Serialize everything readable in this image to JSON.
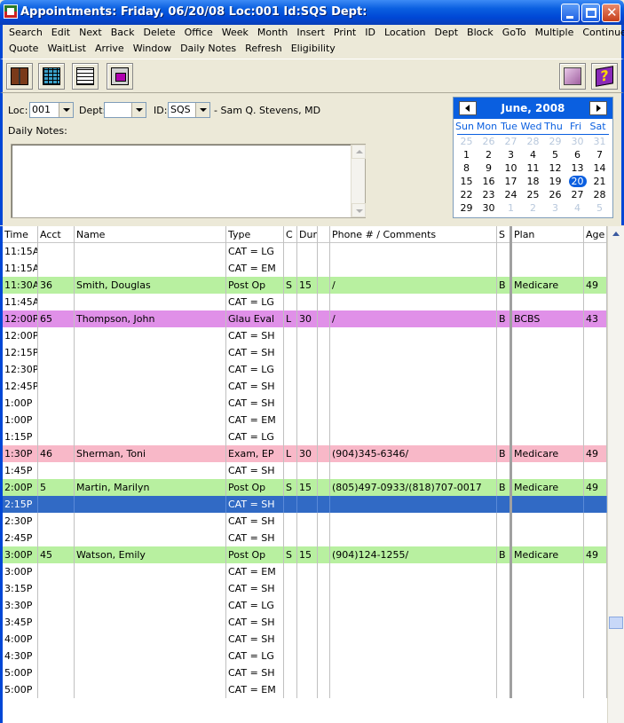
{
  "window": {
    "title": "Appointments: Friday, 06/20/08 Loc:001 Id:SQS Dept:"
  },
  "menus": {
    "row1": [
      "Search",
      "Edit",
      "Next",
      "Back",
      "Delete",
      "Office",
      "Week",
      "Month",
      "Insert",
      "Print",
      "ID",
      "Location",
      "Dept",
      "Block",
      "GoTo",
      "Multiple",
      "Continue"
    ],
    "row2": [
      "Quote",
      "WaitList",
      "Arrive",
      "Window",
      "Daily Notes",
      "Refresh",
      "Eligibility"
    ]
  },
  "toolbar": {
    "buttons": [
      "book-icon",
      "grid-icon",
      "month-grid-icon",
      "calendar-icon"
    ],
    "right_buttons": [
      "folder-icon",
      "help-icon"
    ]
  },
  "form": {
    "loc_label": "Loc:",
    "loc_value": "001",
    "dept_label": "Dept:",
    "dept_value": "",
    "id_label": "ID:",
    "id_value": "SQS",
    "provider": "- Sam Q. Stevens, MD",
    "notes_label": "Daily Notes:"
  },
  "calendar": {
    "title": "June, 2008",
    "dow": [
      "Sun",
      "Mon",
      "Tue",
      "Wed",
      "Thu",
      "Fri",
      "Sat"
    ],
    "weeks": [
      [
        [
          "25",
          true
        ],
        [
          "26",
          true
        ],
        [
          "27",
          true
        ],
        [
          "28",
          true
        ],
        [
          "29",
          true
        ],
        [
          "30",
          true
        ],
        [
          "31",
          true
        ]
      ],
      [
        [
          "1",
          false
        ],
        [
          "2",
          false
        ],
        [
          "3",
          false
        ],
        [
          "4",
          false
        ],
        [
          "5",
          false
        ],
        [
          "6",
          false
        ],
        [
          "7",
          false
        ]
      ],
      [
        [
          "8",
          false
        ],
        [
          "9",
          false
        ],
        [
          "10",
          false
        ],
        [
          "11",
          false
        ],
        [
          "12",
          false
        ],
        [
          "13",
          false
        ],
        [
          "14",
          false
        ]
      ],
      [
        [
          "15",
          false
        ],
        [
          "16",
          false
        ],
        [
          "17",
          false
        ],
        [
          "18",
          false
        ],
        [
          "19",
          false
        ],
        [
          "20",
          false
        ],
        [
          "21",
          false
        ]
      ],
      [
        [
          "22",
          false
        ],
        [
          "23",
          false
        ],
        [
          "24",
          false
        ],
        [
          "25",
          false
        ],
        [
          "26",
          false
        ],
        [
          "27",
          false
        ],
        [
          "28",
          false
        ]
      ],
      [
        [
          "29",
          false
        ],
        [
          "30",
          false
        ],
        [
          "1",
          true
        ],
        [
          "2",
          true
        ],
        [
          "3",
          true
        ],
        [
          "4",
          true
        ],
        [
          "5",
          true
        ]
      ]
    ],
    "selected_day": "20"
  },
  "grid": {
    "columns": [
      "Time",
      "Acct",
      "Name",
      "Type",
      "C",
      "Dur",
      "",
      "Phone # / Comments",
      "S",
      "Plan",
      "Age"
    ],
    "colors": {
      "green": "#b8f0a0",
      "purple": "#e090e8",
      "pink": "#f8b8c8",
      "selected": "#316ac5",
      "none": "#ffffff"
    },
    "rows": [
      {
        "time": "11:15A",
        "acct": "",
        "name": "",
        "type": "CAT = LG",
        "c": "",
        "dur": "",
        "phone": "",
        "s": "",
        "plan": "",
        "age": "",
        "color": "none"
      },
      {
        "time": "11:15A",
        "acct": "",
        "name": "",
        "type": "CAT = EM",
        "c": "",
        "dur": "",
        "phone": "",
        "s": "",
        "plan": "",
        "age": "",
        "color": "none"
      },
      {
        "time": "11:30A",
        "acct": "36",
        "name": "Smith, Douglas",
        "type": "Post Op",
        "c": "S",
        "dur": "15",
        "phone": "/",
        "s": "B",
        "plan": "Medicare",
        "age": "49",
        "color": "green"
      },
      {
        "time": "11:45A",
        "acct": "",
        "name": "",
        "type": "CAT = LG",
        "c": "",
        "dur": "",
        "phone": "",
        "s": "",
        "plan": "",
        "age": "",
        "color": "none"
      },
      {
        "time": "12:00P",
        "acct": "65",
        "name": "Thompson, John",
        "type": "Glau Eval",
        "c": "L",
        "dur": "30",
        "phone": "/",
        "s": "B",
        "plan": "BCBS",
        "age": "43",
        "color": "purple"
      },
      {
        "time": "12:00P",
        "acct": "",
        "name": "",
        "type": "CAT = SH",
        "c": "",
        "dur": "",
        "phone": "",
        "s": "",
        "plan": "",
        "age": "",
        "color": "none"
      },
      {
        "time": "12:15P",
        "acct": "",
        "name": "",
        "type": "CAT = SH",
        "c": "",
        "dur": "",
        "phone": "",
        "s": "",
        "plan": "",
        "age": "",
        "color": "none"
      },
      {
        "time": "12:30P",
        "acct": "",
        "name": "",
        "type": "CAT = LG",
        "c": "",
        "dur": "",
        "phone": "",
        "s": "",
        "plan": "",
        "age": "",
        "color": "none"
      },
      {
        "time": "12:45P",
        "acct": "",
        "name": "",
        "type": "CAT = SH",
        "c": "",
        "dur": "",
        "phone": "",
        "s": "",
        "plan": "",
        "age": "",
        "color": "none"
      },
      {
        "time": "1:00P",
        "acct": "",
        "name": "",
        "type": "CAT = SH",
        "c": "",
        "dur": "",
        "phone": "",
        "s": "",
        "plan": "",
        "age": "",
        "color": "none"
      },
      {
        "time": "1:00P",
        "acct": "",
        "name": "",
        "type": "CAT = EM",
        "c": "",
        "dur": "",
        "phone": "",
        "s": "",
        "plan": "",
        "age": "",
        "color": "none"
      },
      {
        "time": "1:15P",
        "acct": "",
        "name": "",
        "type": "CAT = LG",
        "c": "",
        "dur": "",
        "phone": "",
        "s": "",
        "plan": "",
        "age": "",
        "color": "none"
      },
      {
        "time": "1:30P",
        "acct": "46",
        "name": "Sherman, Toni",
        "type": "Exam, EP",
        "c": "L",
        "dur": "30",
        "phone": "(904)345-6346/",
        "s": "B",
        "plan": "Medicare",
        "age": "49",
        "color": "pink"
      },
      {
        "time": "1:45P",
        "acct": "",
        "name": "",
        "type": "CAT = SH",
        "c": "",
        "dur": "",
        "phone": "",
        "s": "",
        "plan": "",
        "age": "",
        "color": "none"
      },
      {
        "time": "2:00P",
        "acct": "5",
        "name": "Martin, Marilyn",
        "type": "Post Op",
        "c": "S",
        "dur": "15",
        "phone": "(805)497-0933/(818)707-0017",
        "s": "B",
        "plan": "Medicare",
        "age": "49",
        "color": "green"
      },
      {
        "time": "2:15P",
        "acct": "",
        "name": "",
        "type": "CAT = SH",
        "c": "",
        "dur": "",
        "phone": "",
        "s": "",
        "plan": "",
        "age": "",
        "color": "selected"
      },
      {
        "time": "2:30P",
        "acct": "",
        "name": "",
        "type": "CAT = SH",
        "c": "",
        "dur": "",
        "phone": "",
        "s": "",
        "plan": "",
        "age": "",
        "color": "none"
      },
      {
        "time": "2:45P",
        "acct": "",
        "name": "",
        "type": "CAT = SH",
        "c": "",
        "dur": "",
        "phone": "",
        "s": "",
        "plan": "",
        "age": "",
        "color": "none"
      },
      {
        "time": "3:00P",
        "acct": "45",
        "name": "Watson, Emily",
        "type": "Post Op",
        "c": "S",
        "dur": "15",
        "phone": "(904)124-1255/",
        "s": "B",
        "plan": "Medicare",
        "age": "49",
        "color": "green"
      },
      {
        "time": "3:00P",
        "acct": "",
        "name": "",
        "type": "CAT = EM",
        "c": "",
        "dur": "",
        "phone": "",
        "s": "",
        "plan": "",
        "age": "",
        "color": "none"
      },
      {
        "time": "3:15P",
        "acct": "",
        "name": "",
        "type": "CAT = SH",
        "c": "",
        "dur": "",
        "phone": "",
        "s": "",
        "plan": "",
        "age": "",
        "color": "none"
      },
      {
        "time": "3:30P",
        "acct": "",
        "name": "",
        "type": "CAT = LG",
        "c": "",
        "dur": "",
        "phone": "",
        "s": "",
        "plan": "",
        "age": "",
        "color": "none"
      },
      {
        "time": "3:45P",
        "acct": "",
        "name": "",
        "type": "CAT = SH",
        "c": "",
        "dur": "",
        "phone": "",
        "s": "",
        "plan": "",
        "age": "",
        "color": "none"
      },
      {
        "time": "4:00P",
        "acct": "",
        "name": "",
        "type": "CAT = SH",
        "c": "",
        "dur": "",
        "phone": "",
        "s": "",
        "plan": "",
        "age": "",
        "color": "none"
      },
      {
        "time": "4:30P",
        "acct": "",
        "name": "",
        "type": "CAT = LG",
        "c": "",
        "dur": "",
        "phone": "",
        "s": "",
        "plan": "",
        "age": "",
        "color": "none"
      },
      {
        "time": "5:00P",
        "acct": "",
        "name": "",
        "type": "CAT = SH",
        "c": "",
        "dur": "",
        "phone": "",
        "s": "",
        "plan": "",
        "age": "",
        "color": "none"
      },
      {
        "time": "5:00P",
        "acct": "",
        "name": "",
        "type": "CAT = EM",
        "c": "",
        "dur": "",
        "phone": "",
        "s": "",
        "plan": "",
        "age": "",
        "color": "none"
      }
    ]
  }
}
